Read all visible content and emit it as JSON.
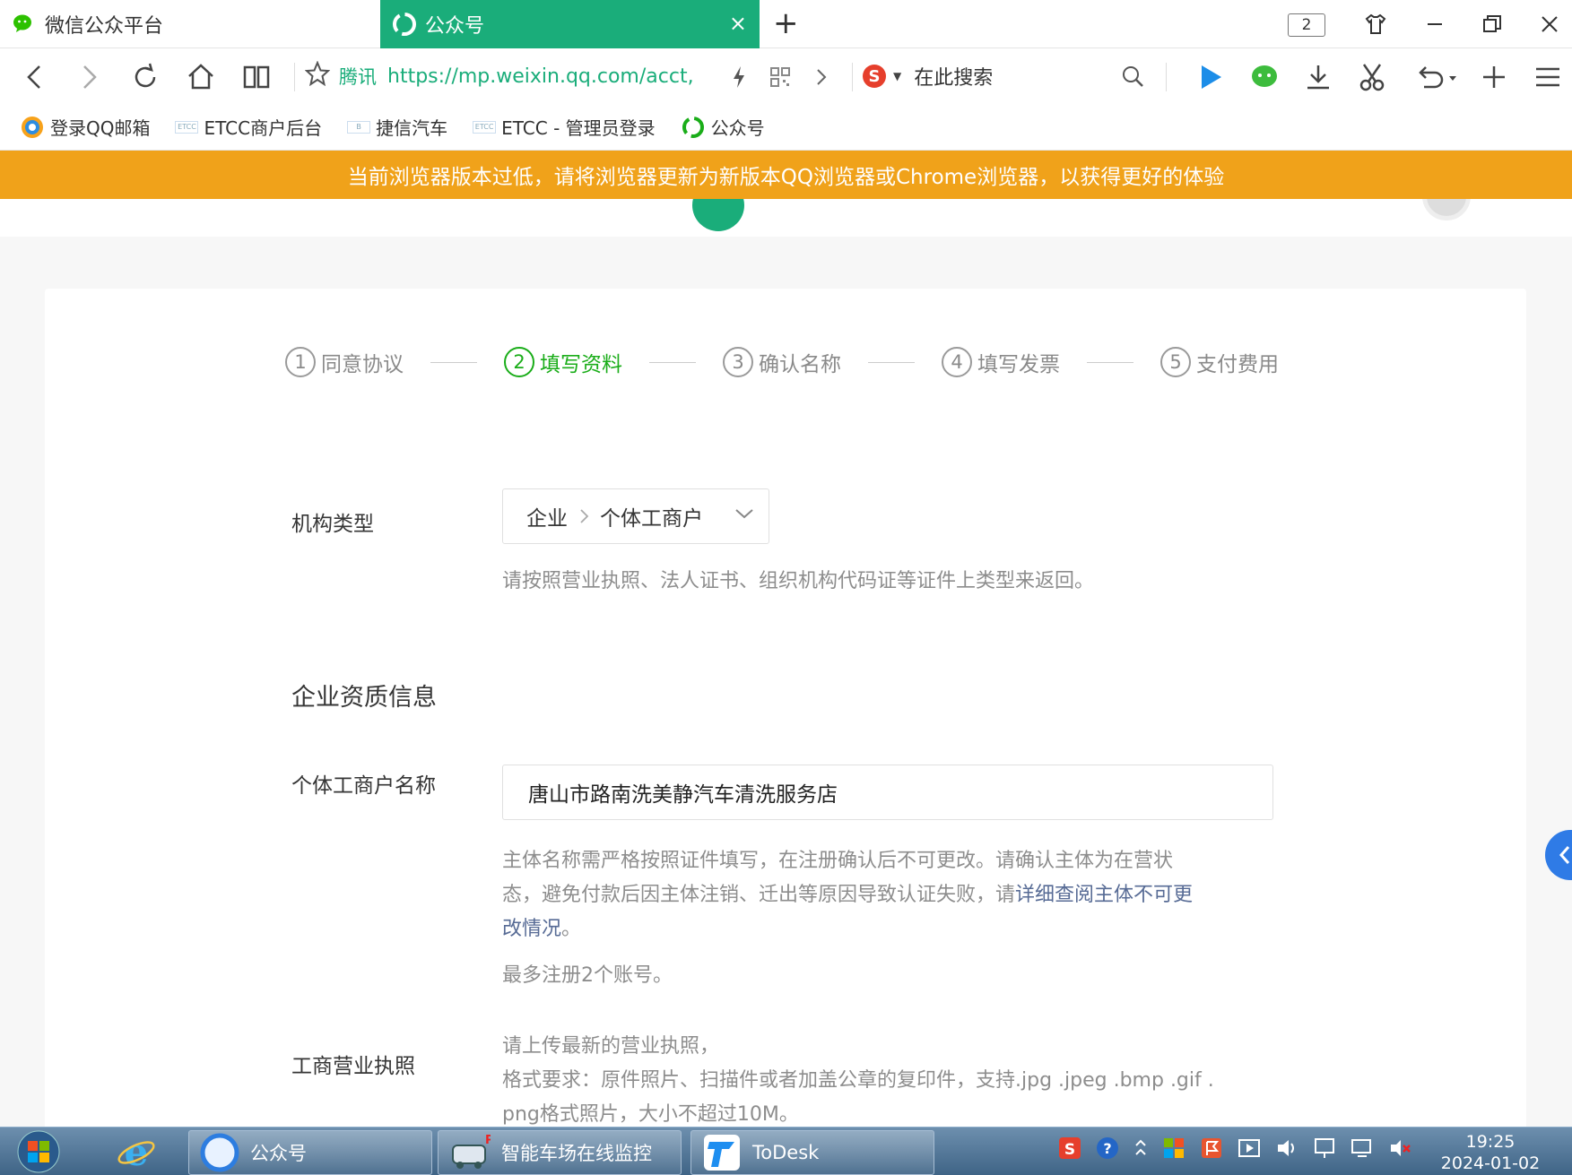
{
  "browser": {
    "tabs": [
      {
        "label": "微信公众平台",
        "active": false
      },
      {
        "label": "公众号",
        "active": true
      }
    ],
    "tab_count": "2",
    "address": {
      "brand": "腾讯",
      "url": "https://mp.weixin.qq.com/acct,"
    },
    "search_placeholder": "在此搜索",
    "bookmarks": [
      {
        "label": "登录QQ邮箱"
      },
      {
        "label": "ETCC商户后台"
      },
      {
        "label": "捷信汽车"
      },
      {
        "label": "ETCC - 管理员登录"
      },
      {
        "label": "公众号"
      }
    ],
    "warning": "当前浏览器版本过低，请将浏览器更新为新版本QQ浏览器或Chrome浏览器，以获得更好的体验"
  },
  "page": {
    "steps": [
      {
        "num": "1",
        "label": "同意协议",
        "active": false
      },
      {
        "num": "2",
        "label": "填写资料",
        "active": true
      },
      {
        "num": "3",
        "label": "确认名称",
        "active": false
      },
      {
        "num": "4",
        "label": "填写发票",
        "active": false
      },
      {
        "num": "5",
        "label": "支付费用",
        "active": false
      }
    ],
    "org_type": {
      "label": "机构类型",
      "value_main": "企业",
      "value_sub": "个体工商户",
      "tip": "请按照营业执照、法人证书、组织机构代码证等证件上类型来返回。"
    },
    "section_title": "企业资质信息",
    "business_name": {
      "label": "个体工商户名称",
      "value": "唐山市路南洗美静汽车清洗服务店",
      "tip_line1": "主体名称需严格按照证件填写，在注册确认后不可更改。请确认主体为在营状",
      "tip_line2a": "态，避免付款后因主体注销、迁出等原因导致认证失败，请",
      "tip_link": "详细查阅主体不可更",
      "tip_line3_link": "改情况",
      "tip_line3_end": "。",
      "tip_limit": "最多注册2个账号。"
    },
    "license": {
      "label": "工商营业执照",
      "tip_line1": "请上传最新的营业执照，",
      "tip_line2": "格式要求：原件照片、扫描件或者加盖公章的复印件，支持.jpg .jpeg .bmp .gif .",
      "tip_line3": "png格式照片，大小不超过10M。"
    }
  },
  "taskbar": {
    "tasks": [
      {
        "label": "公众号"
      },
      {
        "label": "智能车场在线监控"
      },
      {
        "label": "ToDesk"
      }
    ],
    "time": "19:25",
    "date": "2024-01-02"
  },
  "colors": {
    "active_tab": "#1aad7a",
    "warning_bg": "#f0a21a",
    "step_active": "#1aad19",
    "link": "#576b95"
  }
}
